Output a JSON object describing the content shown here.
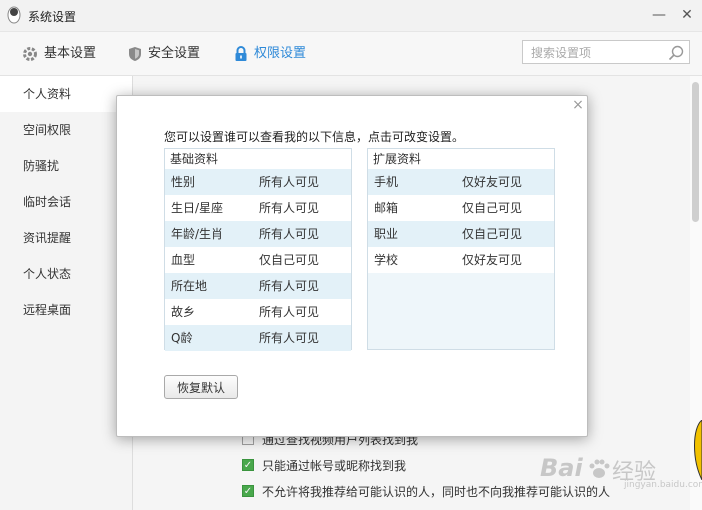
{
  "window": {
    "title": "系统设置",
    "minimize_label": "—",
    "close_label": "✕"
  },
  "toolbar": {
    "tabs": [
      {
        "label": "基本设置",
        "icon": "gear-icon"
      },
      {
        "label": "安全设置",
        "icon": "shield-icon"
      },
      {
        "label": "权限设置",
        "icon": "lock-icon"
      }
    ],
    "active_tab": "权限设置",
    "accent_color": "#2f8ad8"
  },
  "search": {
    "placeholder": "搜索设置项"
  },
  "sidebar": {
    "items": [
      {
        "label": "个人资料"
      },
      {
        "label": "空间权限"
      },
      {
        "label": "防骚扰"
      },
      {
        "label": "临时会话"
      },
      {
        "label": "资讯提醒"
      },
      {
        "label": "个人状态"
      },
      {
        "label": "远程桌面"
      }
    ],
    "active_item": "个人资料"
  },
  "background_options": [
    {
      "label": "通过查找视频用户列表找到我",
      "checked": false
    },
    {
      "label": "只能通过帐号或昵称找到我",
      "checked": true
    },
    {
      "label": "不允许将我推荐给可能认识的人，同时也不向我推荐可能认识的人",
      "checked": true
    }
  ],
  "dialog": {
    "close_label": "×",
    "intro": "您可以设置谁可以查看我的以下信息，点击可改变设置。",
    "basic": {
      "header": "基础资料",
      "rows": [
        {
          "field": "性别",
          "visibility": "所有人可见"
        },
        {
          "field": "生日/星座",
          "visibility": "所有人可见"
        },
        {
          "field": "年龄/生肖",
          "visibility": "所有人可见"
        },
        {
          "field": "血型",
          "visibility": "仅自己可见"
        },
        {
          "field": "所在地",
          "visibility": "所有人可见"
        },
        {
          "field": "故乡",
          "visibility": "所有人可见"
        },
        {
          "field": "Q龄",
          "visibility": "所有人可见"
        }
      ]
    },
    "extended": {
      "header": "扩展资料",
      "rows": [
        {
          "field": "手机",
          "visibility": "仅好友可见"
        },
        {
          "field": "邮箱",
          "visibility": "仅自己可见"
        },
        {
          "field": "职业",
          "visibility": "仅自己可见"
        },
        {
          "field": "学校",
          "visibility": "仅好友可见"
        }
      ]
    },
    "reset_label": "恢复默认"
  },
  "watermark": {
    "brand": "Bai",
    "sub": "经验",
    "url": "jingyan.baidu.com"
  }
}
